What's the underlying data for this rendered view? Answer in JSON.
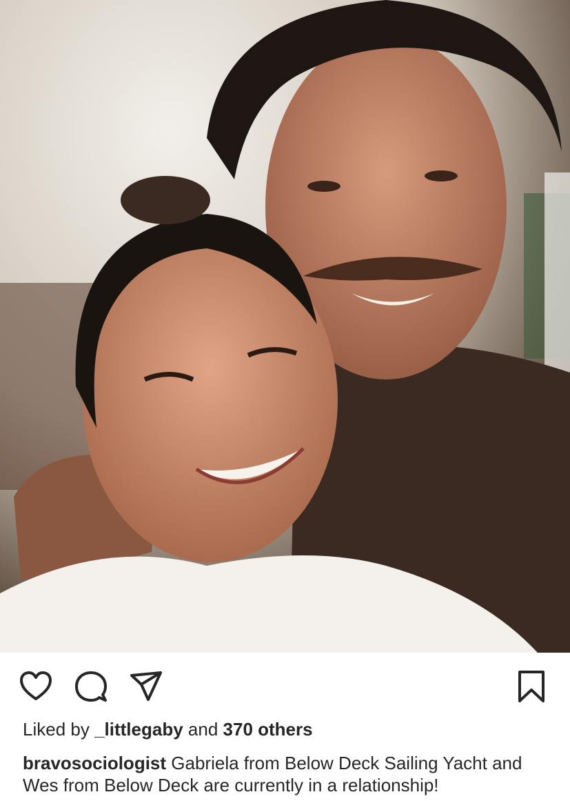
{
  "post": {
    "image_alt": "Selfie of two smiling people",
    "actions": {
      "like_icon": "heart-icon",
      "comment_icon": "comment-icon",
      "share_icon": "send-icon",
      "save_icon": "bookmark-icon"
    },
    "likes": {
      "prefix": "Liked by",
      "user": "_littlegaby",
      "joiner": "and",
      "others": "370 others"
    },
    "caption": {
      "username": "bravosociologist",
      "text": "Gabriela from Below Deck Sailing Yacht and Wes from Below Deck are currently in a relationship!"
    }
  },
  "colors": {
    "text": "#262626",
    "icon": "#262626",
    "background": "#ffffff"
  }
}
